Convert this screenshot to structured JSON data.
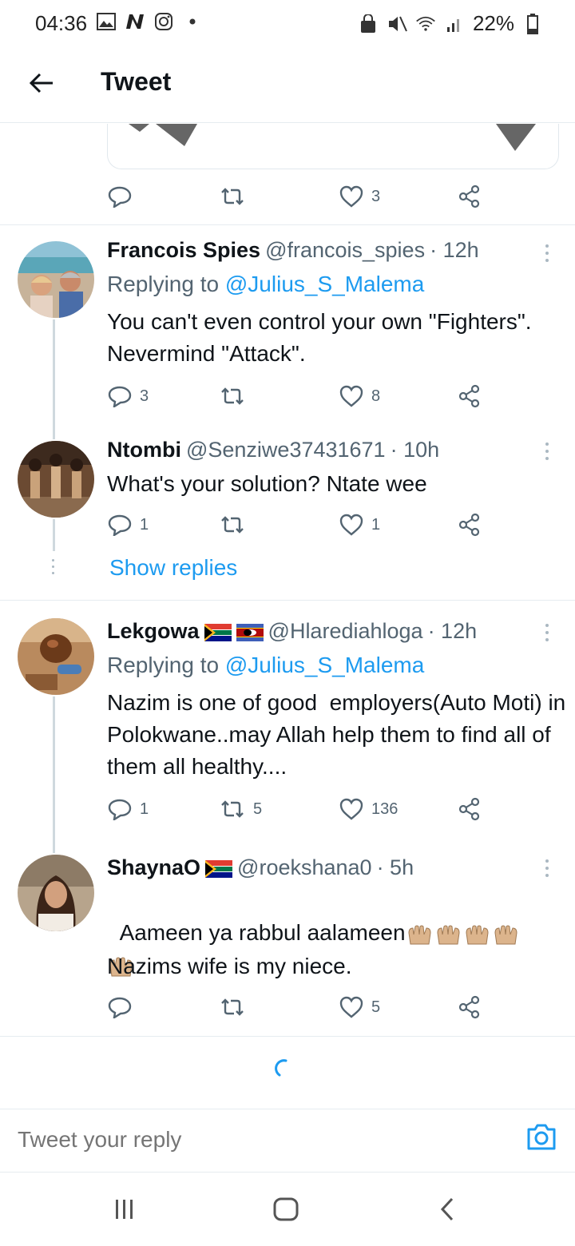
{
  "status": {
    "time": "04:36",
    "battery": "22%"
  },
  "header": {
    "title": "Tweet"
  },
  "top_tweet_actions": {
    "likes": "3"
  },
  "tweets": [
    {
      "name": "Francois Spies",
      "handle": "@francois_spies",
      "time": "· 12h",
      "replying_prefix": "Replying to",
      "replying_to": "@Julius_S_Malema",
      "text": "You can't even control your own \"Fighters\". Nevermind \"Attack\".",
      "replies": "3",
      "retweets": "",
      "likes": "8"
    },
    {
      "name": "Ntombi",
      "handle": "@Senziwe37431671",
      "time": "· 10h",
      "text": "What's your solution? Ntate wee",
      "replies": "1",
      "retweets": "",
      "likes": "1",
      "show_replies": "Show replies"
    },
    {
      "name": "Lekgowa",
      "handle": "@Hlarediahloga",
      "time": "· 12h",
      "replying_prefix": "Replying to",
      "replying_to": "@Julius_S_Malema",
      "text": "Nazim is one of good  employers(Auto Moti) in Polokwane..may Allah help them to find all of them all healthy....",
      "replies": "1",
      "retweets": "5",
      "likes": "136"
    },
    {
      "name": "ShaynaO",
      "handle": "@roekshana0",
      "time": "· 5h",
      "text_line1": "Aameen ya rabbul aalameen",
      "text_line2": "Nazims wife is my niece.",
      "replies": "",
      "retweets": "",
      "likes": "5"
    }
  ],
  "reply_bar": {
    "placeholder": "Tweet your reply"
  },
  "icons": {
    "back": "arrow-left-icon",
    "reply": "reply-bubble-icon",
    "retweet": "retweet-icon",
    "like": "heart-icon",
    "share": "share-icon",
    "camera": "camera-icon"
  },
  "colors": {
    "accent": "#1d9bf0",
    "muted": "#536471"
  }
}
